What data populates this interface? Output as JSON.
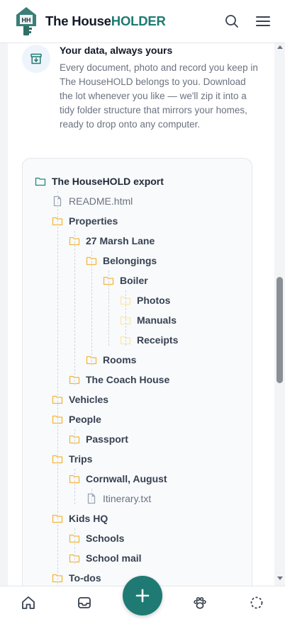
{
  "header": {
    "brand_part1": "The House",
    "brand_part2": "HOLDER",
    "logo_text": "HH",
    "icons": [
      "search-icon",
      "menu-icon"
    ]
  },
  "data_card": {
    "title": "Your data, always yours",
    "body": "Every document, photo and record you keep in The HouseHOLD belongs to you. Download the lot whenever you like — we'll zip it into a tidy folder structure that mirrors your homes, ready to drop onto any computer.",
    "icon": "archive-download-icon"
  },
  "tree": {
    "root": "The HouseHOLD export",
    "items": [
      {
        "label": "README.html",
        "type": "file"
      },
      {
        "label": "Properties",
        "type": "folder"
      },
      {
        "label": "27 Marsh Lane",
        "type": "folder"
      },
      {
        "label": "Belongings",
        "type": "folder"
      },
      {
        "label": "Boiler",
        "type": "folder"
      },
      {
        "label": "Photos",
        "type": "folder-empty"
      },
      {
        "label": "Manuals",
        "type": "folder-empty"
      },
      {
        "label": "Receipts",
        "type": "folder-empty"
      },
      {
        "label": "Rooms",
        "type": "folder"
      },
      {
        "label": "The Coach House",
        "type": "folder"
      },
      {
        "label": "Vehicles",
        "type": "folder"
      },
      {
        "label": "People",
        "type": "folder"
      },
      {
        "label": "Passport",
        "type": "folder"
      },
      {
        "label": "Trips",
        "type": "folder"
      },
      {
        "label": "Cornwall, August",
        "type": "folder"
      },
      {
        "label": "Itinerary.txt",
        "type": "file"
      },
      {
        "label": "Kids HQ",
        "type": "folder"
      },
      {
        "label": "Schools",
        "type": "folder"
      },
      {
        "label": "School mail",
        "type": "folder"
      },
      {
        "label": "To-dos",
        "type": "folder"
      }
    ]
  },
  "bottom_nav": {
    "items": [
      "home-icon",
      "inbox-icon",
      "add-icon",
      "pets-icon",
      "loading-circle-icon"
    ]
  },
  "colors": {
    "brand_teal": "#1f7a73",
    "folder_yellow": "#f5b73b",
    "folder_light": "#fde8a8",
    "root_folder_teal": "#1f8a7c"
  }
}
